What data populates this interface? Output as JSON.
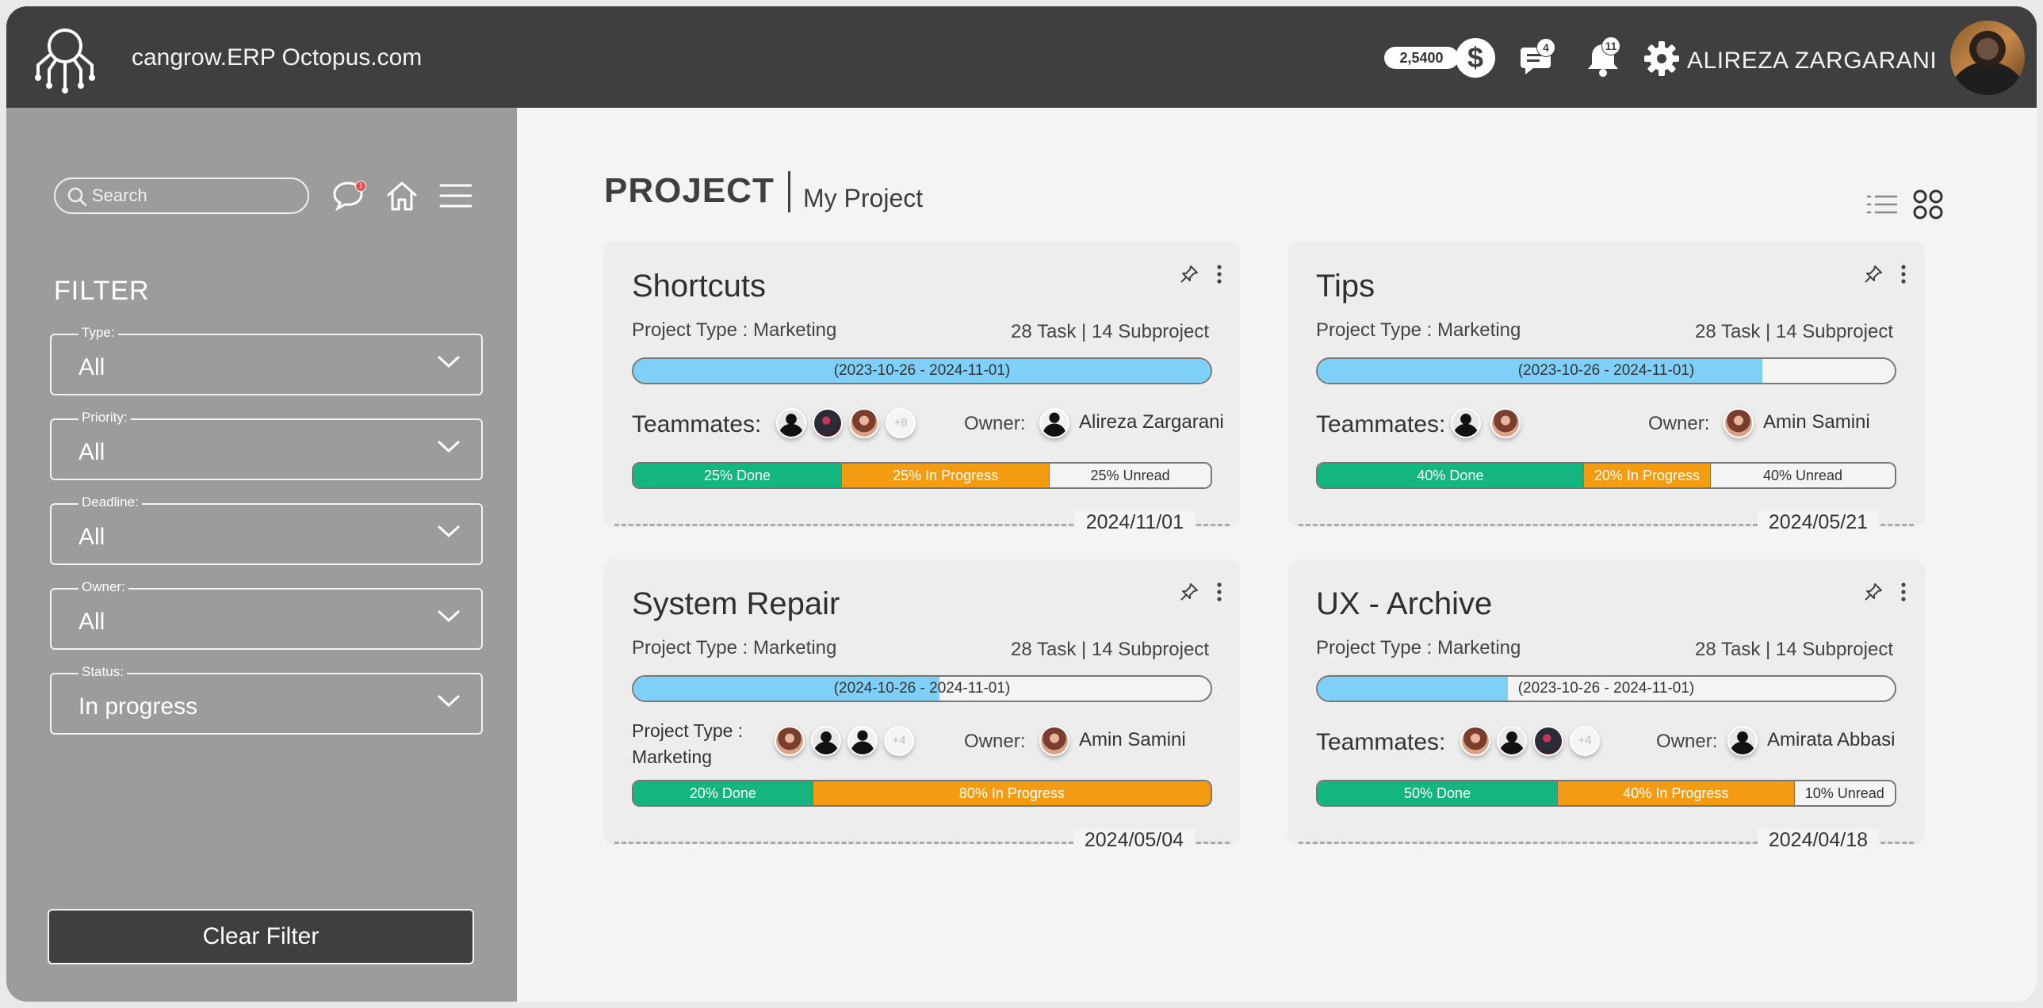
{
  "header": {
    "app_title": "cangrow.ERP Octopus.com",
    "balance": "2,5400",
    "currency_symbol": "$",
    "messages_count": "4",
    "notifications_count": "11",
    "user_name": "ALIREZA ZARGARANI"
  },
  "sidebar": {
    "search_placeholder": "Search",
    "chat_badge": "1",
    "filter_title": "FILTER",
    "filters": [
      {
        "label": "Type:",
        "value": "All"
      },
      {
        "label": "Priority:",
        "value": "All"
      },
      {
        "label": "Deadline:",
        "value": "All"
      },
      {
        "label": "Owner:",
        "value": "All"
      },
      {
        "label": "Status:",
        "value": "In progress"
      }
    ],
    "clear_button": "Clear Filter"
  },
  "main": {
    "title": "PROJECT",
    "subtitle": "My Project",
    "cards": [
      {
        "title": "Shortcuts",
        "project_type": "Project Type : Marketing",
        "tasks": "28 Task | 14 Subproject",
        "timeline": "(2023-10-26 - 2024-11-01)",
        "timeline_progress": 1.0,
        "team_label": "Teammates:",
        "more_label": "+8",
        "owner_label": "Owner:",
        "owner_name": "Alireza Zargarani",
        "done": "25% Done",
        "in_progress": "25% In Progress",
        "unread": "25% Unread",
        "date": "2024/11/01"
      },
      {
        "title": "Tips",
        "project_type": "Project Type : Marketing",
        "tasks": "28 Task | 14 Subproject",
        "timeline": "(2023-10-26 - 2024-11-01)",
        "timeline_progress": 0.77,
        "team_label": "Teammates:",
        "owner_label": "Owner:",
        "owner_name": "Amin Samini",
        "done": "40% Done",
        "in_progress": "20% In Progress",
        "unread": "40% Unread",
        "date": "2024/05/21"
      },
      {
        "title": "System Repair",
        "project_type": "Project Type : Marketing",
        "tasks": "28 Task | 14 Subproject",
        "timeline": "(2024-10-26 - 2024-11-01)",
        "timeline_progress": 0.53,
        "team_label_line1": "Project Type :",
        "team_label_line2": "Marketing",
        "more_label": "+4",
        "owner_label": "Owner:",
        "owner_name": "Amin Samini",
        "done": "20% Done",
        "in_progress": "80% In Progress",
        "date": "2024/05/04"
      },
      {
        "title": "UX - Archive",
        "project_type": "Project Type : Marketing",
        "tasks": "28 Task | 14 Subproject",
        "timeline": "(2023-10-26 - 2024-11-01)",
        "timeline_progress": 0.33,
        "team_label": "Teammates:",
        "more_label": "+4",
        "owner_label": "Owner:",
        "owner_name": "Amirata Abbasi",
        "done": "50% Done",
        "in_progress": "40% In Progress",
        "unread": "10% Unread",
        "date": "2024/04/18"
      }
    ]
  },
  "icons": {
    "logo": "octopus-network-logo",
    "messages": "chat-bubble-icon",
    "notifications": "bell-icon",
    "settings": "gear-icon",
    "search": "search-icon",
    "home": "home-icon",
    "menu": "hamburger-menu-icon",
    "list_view": "list-view-icon",
    "grid_view": "grid-view-icon",
    "pin": "pin-icon",
    "more": "more-vertical-icon",
    "dropdown": "chevron-down-icon"
  },
  "colors": {
    "topbar": "#3f3f3f",
    "sidebar": "#9c9c9c",
    "timeline": "#7fd0f8",
    "done": "#14b57f",
    "in_progress": "#f39c12"
  }
}
